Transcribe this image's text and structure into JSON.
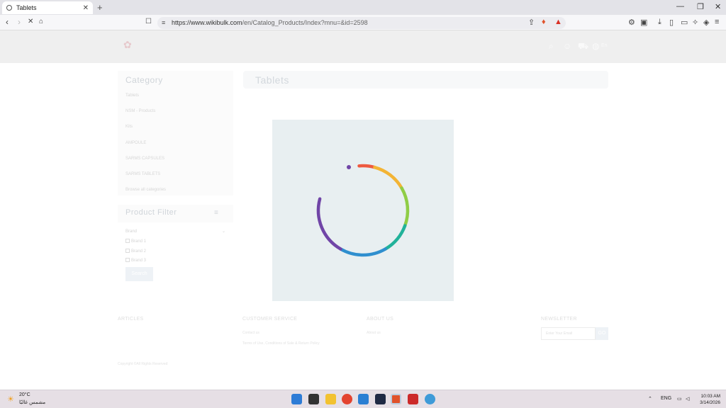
{
  "browser": {
    "tab_title": "Tablets",
    "tab_close": "✕",
    "new_tab": "+",
    "url_host": "https://www.wikibulk.com",
    "url_path": "/en/Catalog_Products/Index?mnu=&id=2598",
    "window_controls": [
      "—",
      "❐",
      "✕"
    ]
  },
  "site": {
    "lang": "En",
    "category_title": "Category",
    "categories": [
      "Tablets",
      "NSM - Products",
      "Kits",
      "AMPOULE",
      "SARMS CAPSULES",
      "SARMS TABLETS",
      "Browse all categories"
    ],
    "filter_title": "Product Filter",
    "filter_brand_label": "Brand",
    "filter_options": [
      "Brand 1",
      "Brand 2",
      "Brand 3"
    ],
    "search_button": "Search",
    "main_title": "Tablets"
  },
  "footer": {
    "col1_title": "ARTICLES",
    "col2_title": "CUSTOMER SERVICE",
    "col2_links": [
      "Contact us",
      "Terms of Use, Conditions of Sale & Return Policy"
    ],
    "col3_title": "ABOUT US",
    "col3_links": [
      "About us"
    ],
    "col4_title": "NEWSLETTER",
    "newsletter_placeholder": "Enter Your Email",
    "newsletter_button": "GO",
    "copyright": "Copyright ©All Rights Reserved"
  },
  "taskbar": {
    "temperature": "20°C",
    "weather_desc": "مشمس غالبًا",
    "language": "ENG",
    "time": "10:03 AM",
    "date": "3/14/2026"
  },
  "colors": {
    "header_bg": "#efefef",
    "loader_bg": "#e8eff1",
    "spinner_colors": [
      "#7045a7",
      "#2f8fcf",
      "#21b29a",
      "#8fcd46",
      "#f3b435",
      "#ee5a40"
    ]
  }
}
